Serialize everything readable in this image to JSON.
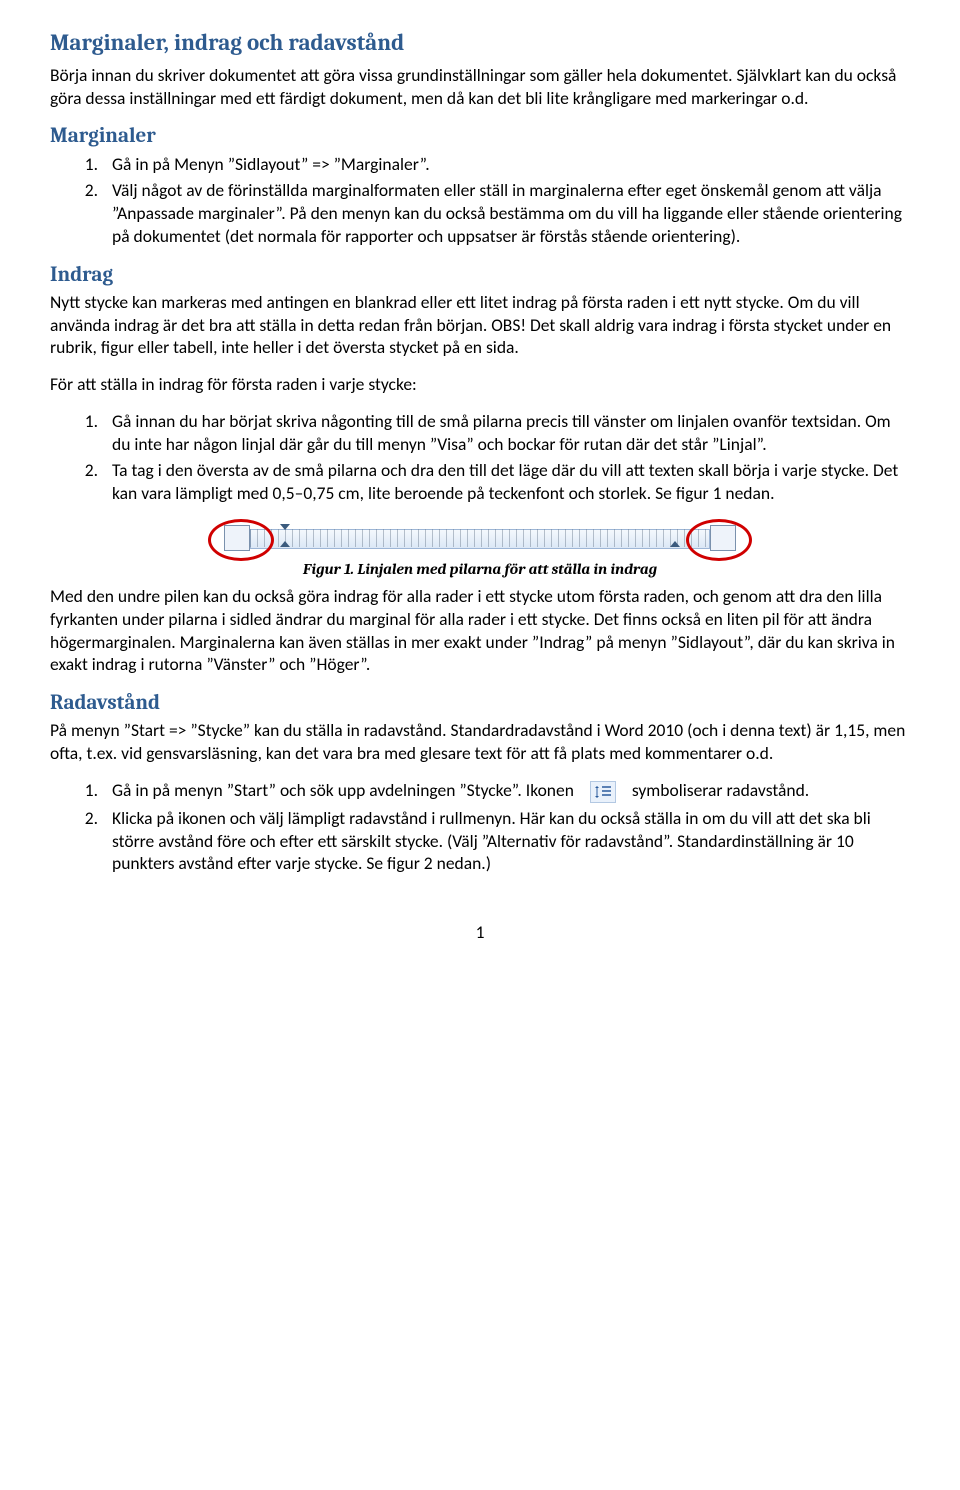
{
  "title": "Marginaler, indrag och radavstånd",
  "intro": "Börja innan du skriver dokumentet att göra vissa grundinställningar som gäller hela dokumentet. Självklart kan du också göra dessa inställningar med ett färdigt dokument, men då kan det bli lite krångligare med markeringar o.d.",
  "sections": {
    "marginaler": {
      "heading": "Marginaler",
      "items": [
        "Gå in på Menyn ”Sidlayout” => ”Marginaler”.",
        "Välj något av de förinställda marginalformaten eller ställ in marginalerna efter eget önskemål genom att välja ”Anpassade marginaler”. På den menyn kan du också bestämma om du vill ha liggande eller stående orientering på dokumentet (det normala för rapporter och uppsatser är förstås stående orientering)."
      ]
    },
    "indrag": {
      "heading": "Indrag",
      "p1": "Nytt stycke kan markeras med antingen en blankrad eller ett litet indrag på första raden i ett nytt stycke. Om du vill använda indrag är det bra att ställa in detta redan från början. OBS! Det skall aldrig vara indrag i första stycket under en rubrik, figur eller tabell, inte heller i det översta stycket på en sida.",
      "p2": "För att ställa in indrag för första raden i varje stycke:",
      "items": [
        "Gå innan du har börjat skriva någonting till de små pilarna precis till vänster om linjalen ovanför textsidan. Om du inte har någon linjal där går du till menyn ”Visa” och bockar för rutan där det står ”Linjal”.",
        "Ta tag i den översta av de små pilarna och dra den till det läge där du vill att texten skall börja i varje stycke. Det kan vara lämpligt med 0,5–0,75 cm, lite beroende på teckenfont och storlek. Se figur 1 nedan."
      ],
      "fig_caption": "Figur 1. Linjalen med pilarna för att ställa in indrag",
      "p3": "Med den undre pilen kan du också göra indrag för alla rader i ett stycke utom första raden, och genom att dra den lilla fyrkanten under pilarna i sidled ändrar du marginal för alla rader i ett stycke. Det finns också en liten pil för att ändra högermarginalen. Marginalerna kan även ställas in mer exakt under ”Indrag” på menyn ”Sidlayout”, där du kan skriva in exakt indrag i rutorna ”Vänster” och ”Höger”."
    },
    "radavstand": {
      "heading": "Radavstånd",
      "p1": "På menyn ”Start => ”Stycke” kan du ställa in radavstånd. Standardradavstånd i Word 2010 (och i denna text) är 1,15, men ofta, t.ex. vid gensvarsläsning, kan det vara bra med glesare text för att få plats med kommentarer o.d.",
      "item1_pre": "Gå in på menyn ”Start” och sök upp avdelningen ”Stycke”. Ikonen",
      "item1_post": "symboliserar radavstånd.",
      "item2": "Klicka på ikonen och välj lämpligt radavstånd i rullmenyn. Här kan du också ställa in om du vill att det ska bli större avstånd före och efter ett särskilt stycke. (Välj ”Alternativ för radavstånd”. Standardinställning är 10 punkters avstånd efter varje stycke. Se figur 2 nedan.)"
    }
  },
  "page_number": "1"
}
